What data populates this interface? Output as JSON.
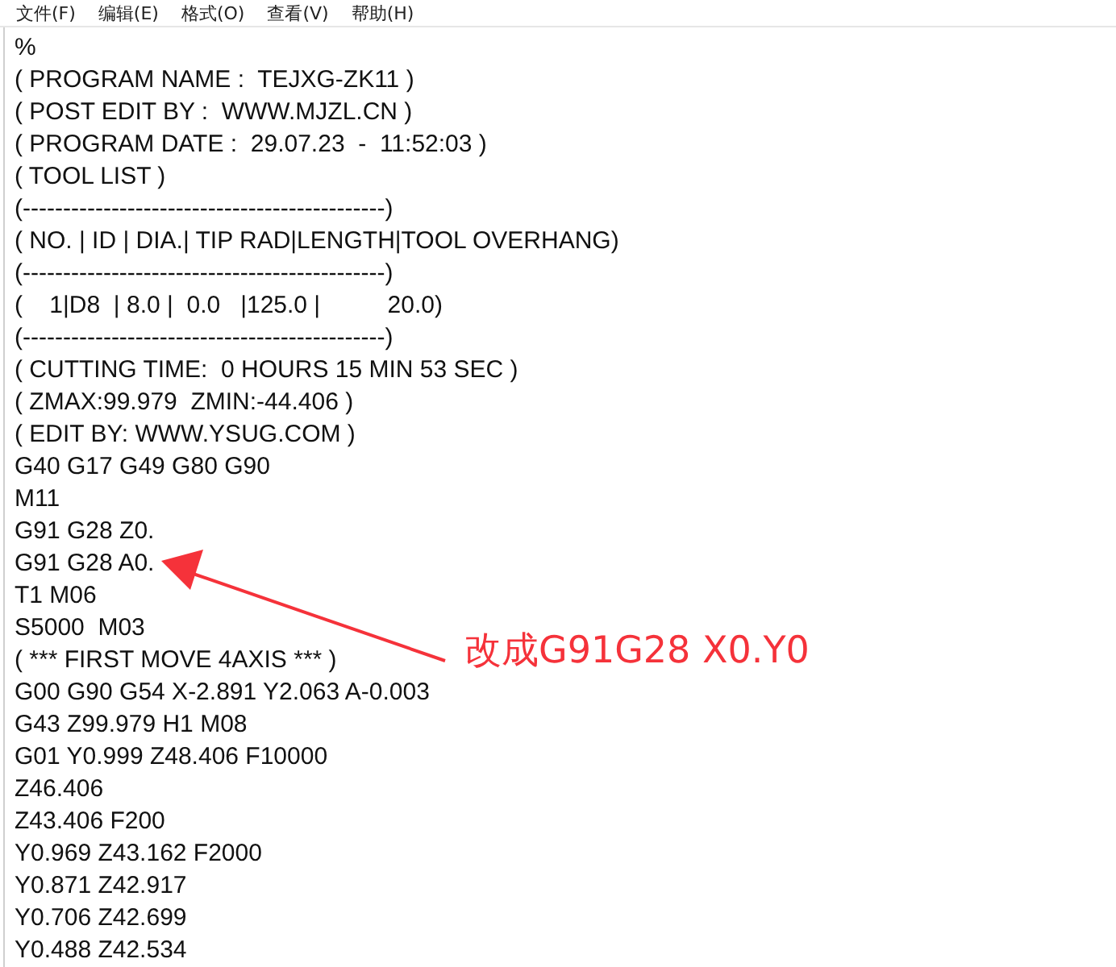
{
  "menu": [
    "文件(F)",
    "编辑(E)",
    "格式(O)",
    "查看(V)",
    "帮助(H)"
  ],
  "lines": [
    "%",
    "( PROGRAM NAME :  TEJXG-ZK11 )",
    "( POST EDIT BY :  WWW.MJZL.CN )",
    "( PROGRAM DATE :  29.07.23  -  11:52:03 )",
    "( TOOL LIST )",
    "(---------------------------------------------)",
    "( NO. | ID | DIA.| TIP RAD|LENGTH|TOOL OVERHANG)",
    "(---------------------------------------------)",
    "(    1|D8  | 8.0 |  0.0   |125.0 |          20.0)",
    "(---------------------------------------------)",
    "( CUTTING TIME:  0 HOURS 15 MIN 53 SEC )",
    "( ZMAX:99.979  ZMIN:-44.406 )",
    "( EDIT BY: WWW.YSUG.COM )",
    "G40 G17 G49 G80 G90",
    "M11",
    "G91 G28 Z0.",
    "G91 G28 A0.",
    "T1 M06",
    "S5000  M03",
    "( *** FIRST MOVE 4AXIS *** )",
    "G00 G90 G54 X-2.891 Y2.063 A-0.003",
    "G43 Z99.979 H1 M08",
    "G01 Y0.999 Z48.406 F10000",
    "Z46.406",
    "Z43.406 F200",
    "Y0.969 Z43.162 F2000",
    "Y0.871 Z42.917",
    "Y0.706 Z42.699",
    "Y0.488 Z42.534"
  ],
  "annotation": {
    "text": "改成G91G28 X0.Y0"
  }
}
